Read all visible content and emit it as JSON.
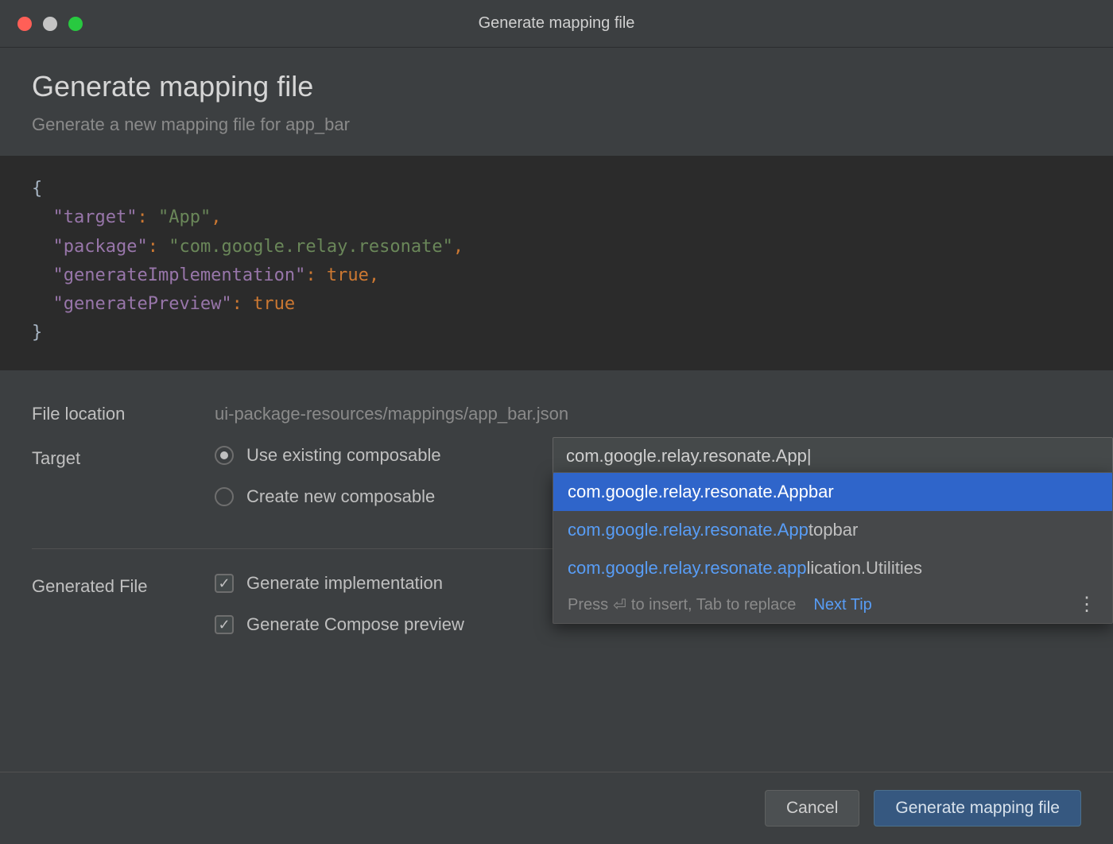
{
  "titlebar": {
    "title": "Generate mapping file"
  },
  "header": {
    "title": "Generate mapping file",
    "subtitle": "Generate a new mapping file for app_bar"
  },
  "code": {
    "target_key": "\"target\"",
    "target_val": "\"App\"",
    "package_key": "\"package\"",
    "package_val": "\"com.google.relay.resonate\"",
    "genimpl_key": "\"generateImplementation\"",
    "genimpl_val": "true",
    "genprev_key": "\"generatePreview\"",
    "genprev_val": "true"
  },
  "form": {
    "file_location_label": "File location",
    "file_location_value": "ui-package-resources/mappings/app_bar.json",
    "target_label": "Target",
    "target_options": {
      "use_existing": "Use existing composable",
      "create_new": "Create new composable"
    },
    "target_input_value": "com.google.relay.resonate.App|",
    "generated_file_label": "Generated File",
    "gen_impl": "Generate implementation",
    "gen_preview": "Generate Compose preview"
  },
  "autocomplete": {
    "items": [
      {
        "match": "com.google.relay.resonate.App",
        "rest": "bar",
        "selected": true
      },
      {
        "match": "com.google.relay.resonate.App",
        "rest": "topbar",
        "selected": false
      },
      {
        "match": "com.google.relay.resonate.app",
        "rest": "lication.Utilities",
        "selected": false
      }
    ],
    "hint_prefix": "Press ",
    "hint_mid": " to insert, Tab to replace",
    "next_tip": "Next Tip"
  },
  "footer": {
    "cancel": "Cancel",
    "generate": "Generate mapping file"
  }
}
